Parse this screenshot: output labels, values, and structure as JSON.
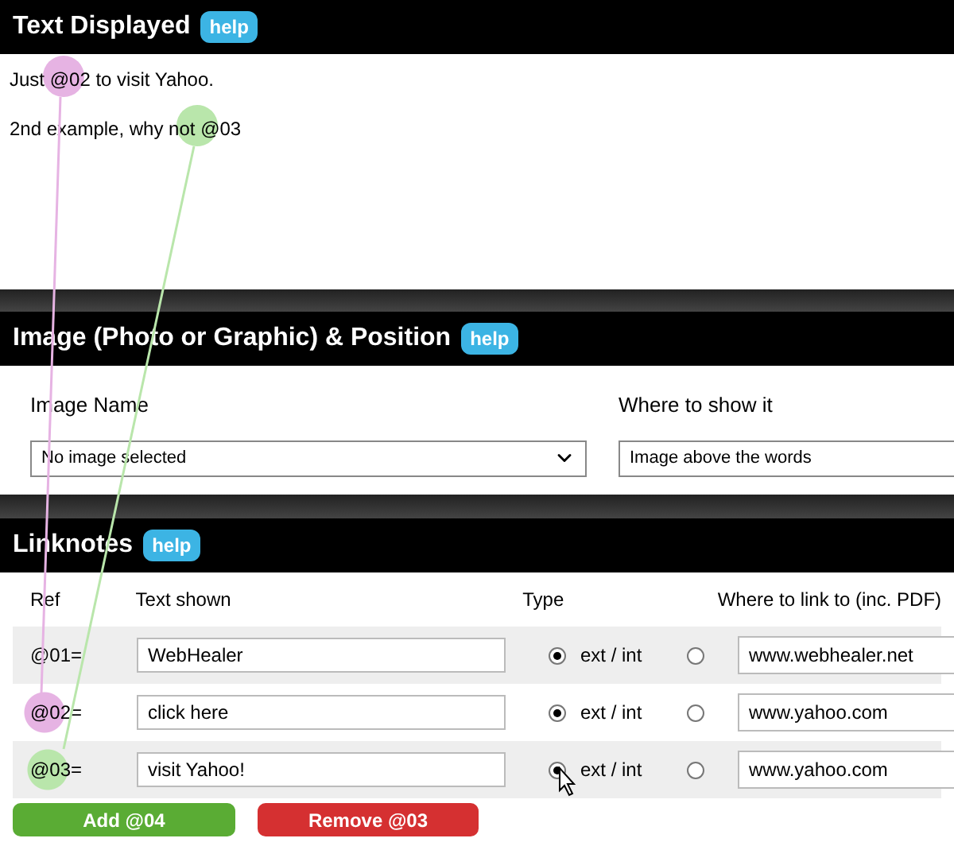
{
  "text_section": {
    "title": "Text Displayed",
    "help": "help",
    "lines": [
      "Just @02 to visit Yahoo.",
      "2nd example, why not @03"
    ]
  },
  "image_section": {
    "title": "Image (Photo or Graphic) & Position",
    "help": "help",
    "image_label": "Image Name",
    "image_value": "No image selected",
    "position_label": "Where to show it",
    "position_value": "Image above the words"
  },
  "linknotes": {
    "title": "Linknotes",
    "help": "help",
    "columns": [
      "Ref",
      "Text shown",
      "Type",
      "Where to link to (inc. PDF)"
    ],
    "rows": [
      {
        "ref": "@01=",
        "text": "WebHealer",
        "radios": [
          {
            "label": "ext / int",
            "selected": true
          },
          {
            "selected": false
          }
        ],
        "url": "www.webhealer.net"
      },
      {
        "ref": "@02=",
        "text": "click here",
        "radios": [
          {
            "label": "ext / int",
            "selected": true
          },
          {
            "selected": false
          }
        ],
        "url": "www.yahoo.com",
        "color": "#e6b3e3"
      },
      {
        "ref": "@03=",
        "text": "visit Yahoo!",
        "radios": [
          {
            "label": "ext / int",
            "selected": true
          },
          {
            "selected": false
          }
        ],
        "url": "www.yahoo.com",
        "color": "#b9e6ab"
      }
    ],
    "add_button": "Add @04",
    "remove_button": "Remove @03"
  }
}
